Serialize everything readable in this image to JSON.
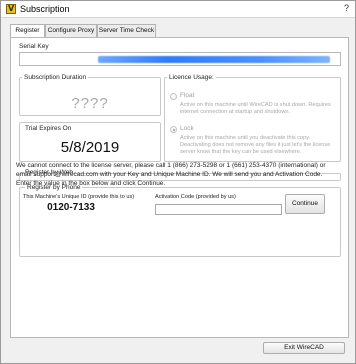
{
  "window": {
    "title": "Subscription",
    "help_glyph": "?"
  },
  "tabs": [
    {
      "label": "Register",
      "active": true
    },
    {
      "label": "Configure Proxy",
      "active": false
    },
    {
      "label": "Server Time Check",
      "active": false
    }
  ],
  "serial_key": {
    "label": "Serial Key",
    "value_redacted": true
  },
  "subscription_duration": {
    "legend": "Subscription Duration",
    "value": "????"
  },
  "licence_usage": {
    "legend": "Licence Usage:",
    "options": [
      {
        "label": "Float",
        "selected": false,
        "description": "Active on this machine until WireCAD is shut down. Requires internet connection at startup and shutdown."
      },
      {
        "label": "Lock",
        "selected": true,
        "description": "Active on this machine until you deactivate this copy. Deactivating does not remove any files it just let's the license server know that the key can be used elsewhere."
      }
    ]
  },
  "trial": {
    "label": "Trial Expires On",
    "date": "5/8/2019"
  },
  "register_by_web": {
    "legend": "Register by Web"
  },
  "register_by_phone": {
    "legend": "Register by Phone",
    "instructions": "We cannot connect to the license server, please call 1 (866) 273-5298 or 1 (661) 253-4370 (international) or email support@wirecad.com with your Key and Unique Machine ID. We will send you and Activation Code. Enter the value in the box below and click Continue.",
    "unique_id_label": "This Machine's Unique ID (provide this to us)",
    "unique_id": "0120-7133",
    "activation_label": "Activation Code (provided by us)",
    "activation_value": "",
    "continue_label": "Continue"
  },
  "footer": {
    "exit_label": "Exit WireCAD"
  },
  "colors": {
    "serial_highlight": "#2f7cf6",
    "app_icon": "#e7c322"
  }
}
